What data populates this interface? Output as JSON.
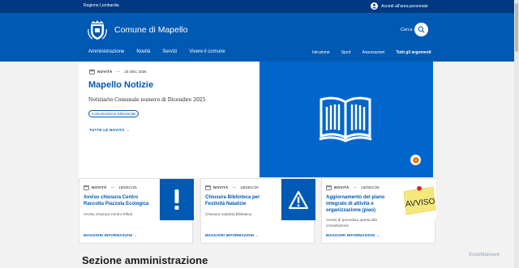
{
  "topbar": {
    "region": "Regione Lombardia",
    "login": "Accedi all'area personale"
  },
  "header": {
    "title": "Comune di Mapello",
    "search_label": "Cerca"
  },
  "nav": {
    "main": [
      "Amministrazione",
      "Novità",
      "Servizi",
      "Vivere il comune"
    ],
    "secondary": [
      "Istruzione",
      "Sport",
      "Associazioni"
    ],
    "all_topics": "Tutti gli argomenti"
  },
  "hero": {
    "category": "NOVITÀ",
    "date": "23 DEC 2025",
    "title": "Mapello Notizie",
    "description": "Notiziario Comunale numero di Dicembre 2025",
    "tag": "Comunicazione istituzionale",
    "link": "TUTTE LE NOVITÀ"
  },
  "cards": [
    {
      "category": "NOVITÀ",
      "date": "19/DEC/25",
      "title_lines": [
        "Avviso chiusura Centro",
        "Raccolta Piazzola Ecologica"
      ],
      "desc_lines": [
        "Avviso chiusura Centro Rifiuti"
      ],
      "link": "MAGGIORI INFORMAZIONI",
      "icon": "exclamation-icon"
    },
    {
      "category": "NOVITÀ",
      "date": "18/DEC/25",
      "title_lines": [
        "Chiusura Biblioteca per",
        "Festività Natalizie"
      ],
      "desc_lines": [
        "Chiusura natalizia biblioteca"
      ],
      "link": "MAGGIORI INFORMAZIONI",
      "icon": "warning-triangle-icon"
    },
    {
      "category": "NOVITÀ",
      "date": "16/DEC/25",
      "title_lines": [
        "Aggiornamento del piano",
        "integrato di attività e",
        "organizzazione (piao)"
      ],
      "desc_lines": [
        "Avviso di procedura aperta alla",
        "consultazione"
      ],
      "link": "MAGGIORI INFORMAZIONI",
      "icon": "avviso-note-icon",
      "icon_text": "AVVISO"
    }
  ],
  "section": {
    "title": "Sezione amministrazione"
  },
  "watermark": "ScanMalware",
  "colors": {
    "topbar": "#003882",
    "header": "#0059b3",
    "accent": "#0059b3",
    "hero_image": "#0066cc",
    "note": "#f5e77a"
  }
}
